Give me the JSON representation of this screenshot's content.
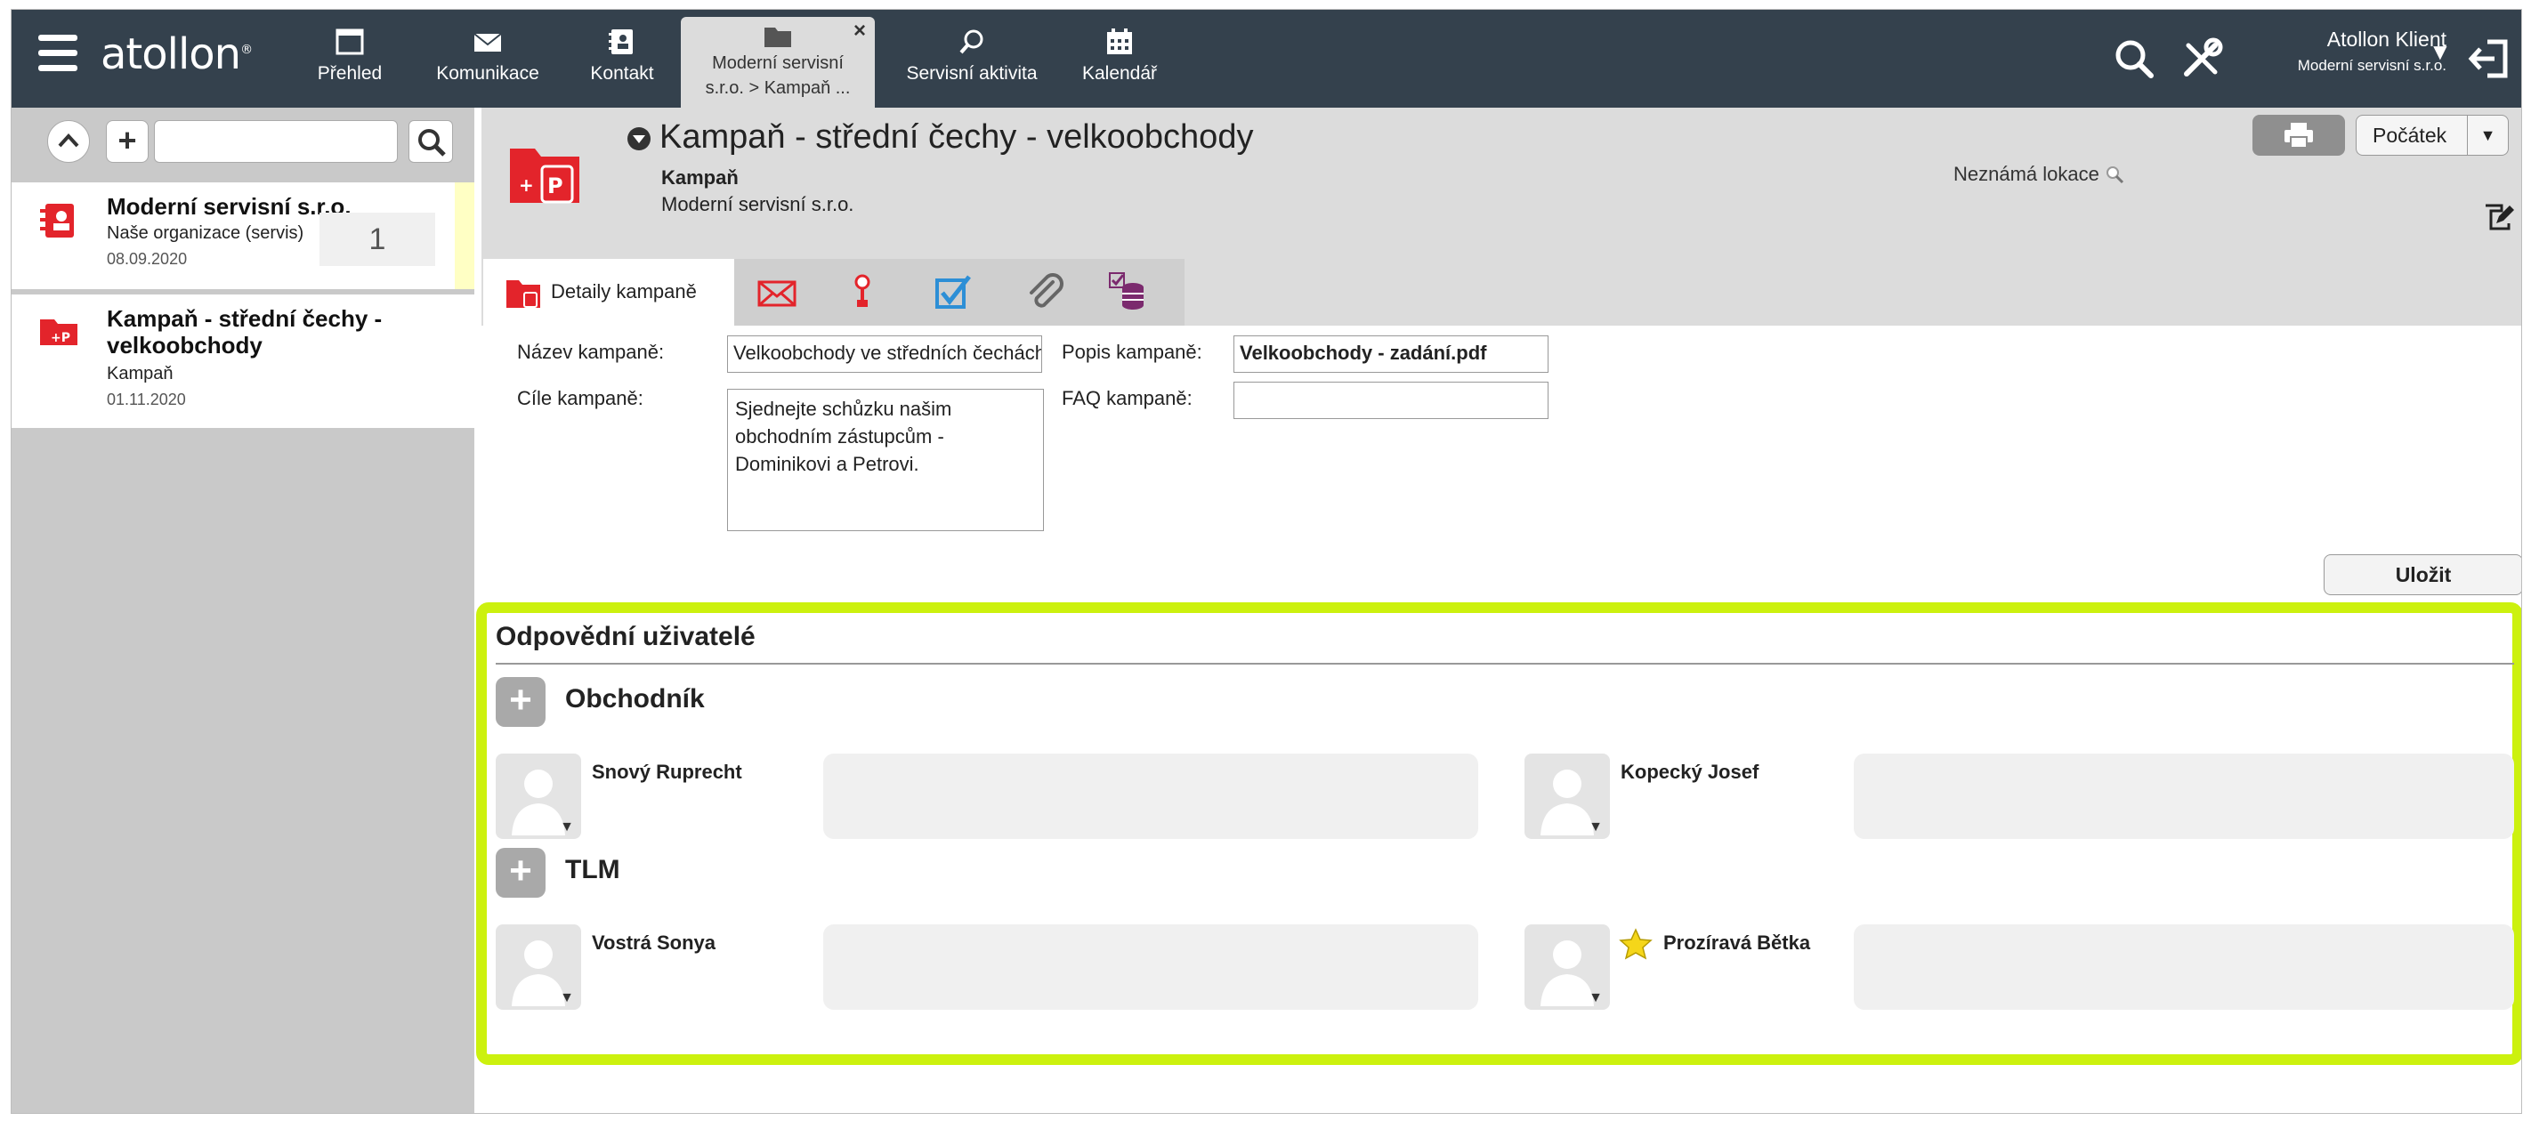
{
  "app": {
    "logo": "atollon",
    "logo_mark": "®"
  },
  "nav": {
    "items": [
      {
        "label": "Přehled",
        "icon": "window-icon"
      },
      {
        "label": "Komunikace",
        "icon": "envelope-icon"
      },
      {
        "label": "Kontakt",
        "icon": "contact-book-icon"
      },
      {
        "label": "Moderní servisní s.r.o. > Kampaň ...",
        "line1": "Moderní servisní",
        "line2": "s.r.o. > Kampaň ...",
        "icon": "campaign-folder-icon",
        "active": true,
        "close": "×"
      },
      {
        "label": "Servisní aktivita",
        "icon": "service-activity-icon"
      },
      {
        "label": "Kalendář",
        "icon": "calendar-icon"
      }
    ],
    "user_name": "Atollon Klient",
    "user_org": "Moderní servisní s.r.o.",
    "user_caret": "▼"
  },
  "left_panel": {
    "search_placeholder": "",
    "items": [
      {
        "title": "Moderní servisní s.r.o.",
        "subtitle": "Naše organizace (servis)",
        "date": "08.09.2020",
        "count": "1"
      },
      {
        "title": "Kampaň - střední čechy - velkoobchody",
        "subtitle": "Kampaň",
        "date": "01.11.2020"
      }
    ]
  },
  "header": {
    "title": "Kampaň - střední čechy - velkoobchody",
    "type": "Kampaň",
    "organization": "Moderní servisní s.r.o.",
    "location": "Neznámá lokace",
    "start_button": "Počátek",
    "start_caret": "▼"
  },
  "tabs": {
    "active_label": "Detaily kampaně",
    "icons": [
      "envelope-red-icon",
      "pin-icon",
      "checkbox-icon",
      "paperclip-icon",
      "coins-icon"
    ]
  },
  "form": {
    "name_label": "Název kampaně:",
    "name_value": "Velkoobchody ve středních čechách",
    "desc_label": "Popis kampaně:",
    "desc_value": "Velkoobchody - zadání.pdf",
    "goals_label": "Cíle kampaně:",
    "goals_value": "Sjednejte schůzku našim obchodním zástupcům - Dominikovi a Petrovi.",
    "faq_label": "FAQ kampaně:",
    "faq_value": "",
    "save_button": "Uložit"
  },
  "responsible": {
    "title": "Odpovědní uživatelé",
    "groups": [
      {
        "name": "Obchodník",
        "add": "+",
        "users": [
          "Snový Ruprecht",
          "Kopecký Josef"
        ]
      },
      {
        "name": "TLM",
        "add": "+",
        "users": [
          "Vostrá Sonya",
          "Prozíravá Bětka"
        ]
      }
    ]
  },
  "colors": {
    "topbar": "#34414d",
    "highlight": "#ccf10e",
    "accent_red": "#e3242b"
  }
}
